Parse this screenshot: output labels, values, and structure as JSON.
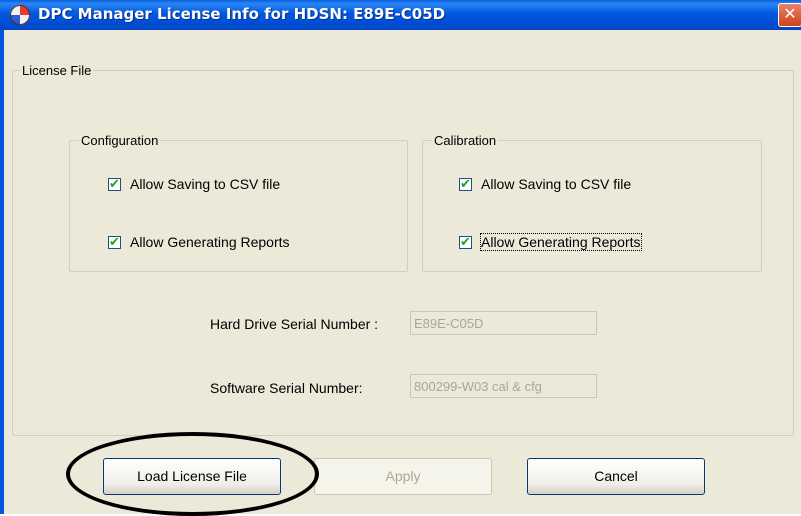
{
  "window": {
    "title": "DPC Manager License Info for HDSN: E89E-C05D",
    "close_glyph": "✕",
    "title_bar_color": "#0058e0"
  },
  "license_file": {
    "legend": "License File",
    "configuration": {
      "legend": "Configuration",
      "allow_csv": {
        "label": "Allow Saving to CSV file",
        "checked": true
      },
      "allow_reports": {
        "label": "Allow Generating Reports",
        "checked": true
      }
    },
    "calibration": {
      "legend": "Calibration",
      "allow_csv": {
        "label": "Allow Saving to CSV file",
        "checked": true
      },
      "allow_reports": {
        "label": "Allow Generating Reports",
        "checked": true
      }
    },
    "hard_drive_serial": {
      "label": "Hard Drive Serial Number :",
      "value": "E89E-C05D"
    },
    "software_serial": {
      "label": "Software Serial Number:",
      "value": "800299-W03 cal & cfg"
    }
  },
  "buttons": {
    "load": "Load License File",
    "apply": "Apply",
    "cancel": "Cancel"
  },
  "check_glyph": "✔"
}
